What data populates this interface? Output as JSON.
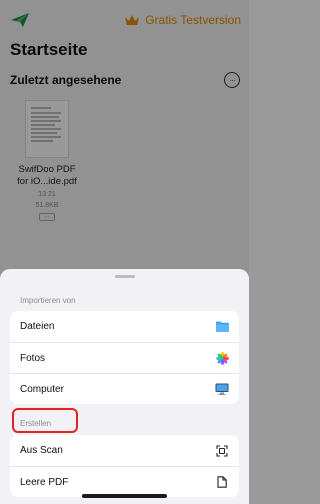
{
  "header": {
    "premium_label": "Gratis Testversion",
    "page_title": "Startseite"
  },
  "recent": {
    "section_title": "Zuletzt angesehene",
    "more_label": "···",
    "files": [
      {
        "name_line1": "SwifDoo PDF",
        "name_line2": "for iO...ide.pdf",
        "time": "13:21",
        "size": "51.8KB",
        "more_label": "···"
      }
    ]
  },
  "sheet": {
    "import_label": "Importieren von",
    "import_items": [
      {
        "label": "Dateien",
        "icon": "folder-icon"
      },
      {
        "label": "Fotos",
        "icon": "photos-icon"
      },
      {
        "label": "Computer",
        "icon": "monitor-icon"
      }
    ],
    "create_label": "Erstellen",
    "create_items": [
      {
        "label": "Aus Scan",
        "icon": "scan-icon"
      },
      {
        "label": "Leere PDF",
        "icon": "blank-document-icon"
      }
    ]
  },
  "colors": {
    "accent": "#e38a00",
    "highlight": "#e32222",
    "folder": "#3aa0f0",
    "logo": "#1e8f4a"
  }
}
